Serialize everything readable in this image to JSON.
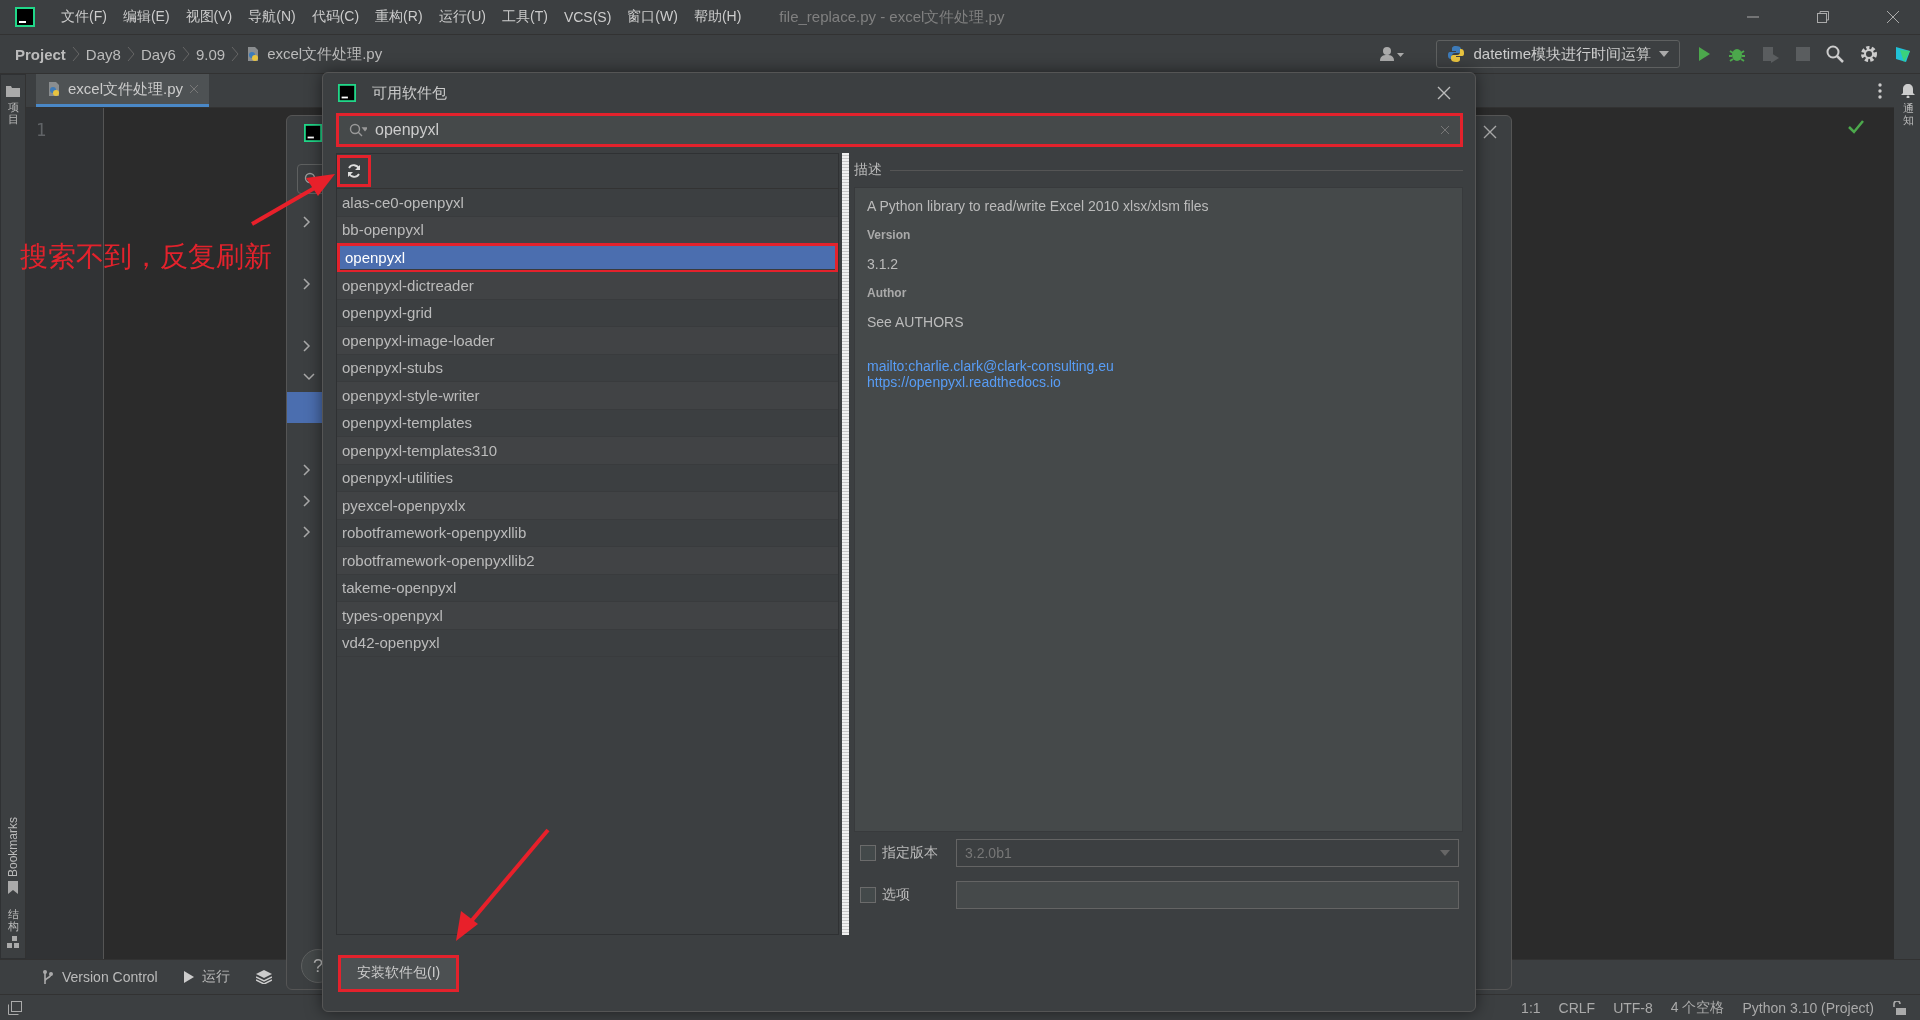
{
  "window": {
    "title": "file_replace.py - excel文件处理.py"
  },
  "menu": [
    "文件(F)",
    "编辑(E)",
    "视图(V)",
    "导航(N)",
    "代码(C)",
    "重构(R)",
    "运行(U)",
    "工具(T)",
    "VCS(S)",
    "窗口(W)",
    "帮助(H)"
  ],
  "breadcrumbs": [
    "Project",
    "Day8",
    "Day6",
    "9.09",
    "excel文件处理.py"
  ],
  "run_config": "datetime模块进行时间运算",
  "editor_tab": {
    "label": "excel文件处理.py"
  },
  "line_numbers": [
    "1"
  ],
  "left_strip": {
    "top": "项目",
    "bookmarks": "Bookmarks",
    "structure": "结构"
  },
  "right_strip": {
    "notifications": "通知"
  },
  "bottom_tools": [
    "Version Control",
    "运行"
  ],
  "status_bar": [
    "1:1",
    "CRLF",
    "UTF-8",
    "4 个空格",
    "Python 3.10 (Project)"
  ],
  "settings_dialog": {
    "tree": [
      {
        "kind": "collapsed"
      },
      {
        "kind": "blank"
      },
      {
        "kind": "collapsed"
      },
      {
        "kind": "blank"
      },
      {
        "kind": "collapsed"
      },
      {
        "kind": "expanded"
      },
      {
        "kind": "selected"
      },
      {
        "kind": "blank"
      },
      {
        "kind": "collapsed"
      },
      {
        "kind": "collapsed"
      },
      {
        "kind": "collapsed"
      }
    ],
    "help": "?"
  },
  "dialog": {
    "title": "可用软件包",
    "search": {
      "value": "openpyxl"
    },
    "packages": [
      {
        "name": "alas-ce0-openpyxl",
        "selected": false
      },
      {
        "name": "bb-openpyxl",
        "selected": false
      },
      {
        "name": "openpyxl",
        "selected": true
      },
      {
        "name": "openpyxl-dictreader",
        "selected": false
      },
      {
        "name": "openpyxl-grid",
        "selected": false
      },
      {
        "name": "openpyxl-image-loader",
        "selected": false
      },
      {
        "name": "openpyxl-stubs",
        "selected": false
      },
      {
        "name": "openpyxl-style-writer",
        "selected": false
      },
      {
        "name": "openpyxl-templates",
        "selected": false
      },
      {
        "name": "openpyxl-templates310",
        "selected": false
      },
      {
        "name": "openpyxl-utilities",
        "selected": false
      },
      {
        "name": "pyexcel-openpyxlx",
        "selected": false
      },
      {
        "name": "robotframework-openpyxllib",
        "selected": false
      },
      {
        "name": "robotframework-openpyxllib2",
        "selected": false
      },
      {
        "name": "takeme-openpyxl",
        "selected": false
      },
      {
        "name": "types-openpyxl",
        "selected": false
      },
      {
        "name": "vd42-openpyxl",
        "selected": false
      }
    ],
    "description": {
      "heading": "描述",
      "summary": "A Python library to read/write Excel 2010 xlsx/xlsm files",
      "fields": [
        {
          "label": "Version",
          "value": "3.1.2"
        },
        {
          "label": "Author",
          "value": "See AUTHORS"
        }
      ],
      "links": [
        "mailto:charlie.clark@clark-consulting.eu",
        "https://openpyxl.readthedocs.io"
      ]
    },
    "options": [
      {
        "kind": "dropdown",
        "label": "指定版本",
        "checked": false,
        "value": "3.2.0b1"
      },
      {
        "kind": "text",
        "label": "选项",
        "checked": false
      }
    ],
    "install_button": "安装软件包(I)"
  },
  "annotation": {
    "text": "搜索不到，反复刷新"
  }
}
